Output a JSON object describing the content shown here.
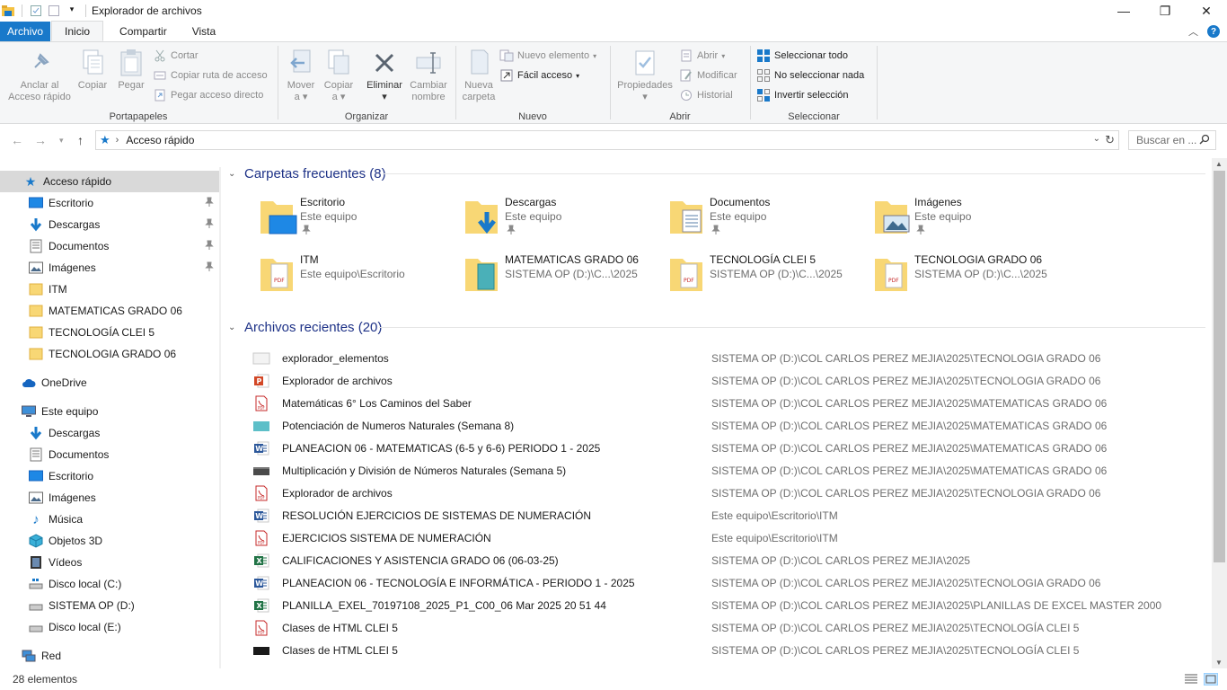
{
  "window": {
    "title": "Explorador de archivos",
    "controls": {
      "minimize": "—",
      "maximize": "❐",
      "close": "✕"
    }
  },
  "ribbon_tabs": [
    {
      "label": "Archivo"
    },
    {
      "label": "Inicio"
    },
    {
      "label": "Compartir"
    },
    {
      "label": "Vista"
    }
  ],
  "ribbon": {
    "portapapeles": {
      "label": "Portapapeles",
      "pin": "Anclar al\nAcceso rápido",
      "pin_1": "Anclar al",
      "pin_2": "Acceso rápido",
      "copy": "Copiar",
      "paste": "Pegar",
      "cut": "Cortar",
      "copy_path": "Copiar ruta de acceso",
      "paste_shortcut": "Pegar acceso directo"
    },
    "organizar": {
      "label": "Organizar",
      "move_1": "Mover",
      "move_2": "a",
      "copy_1": "Copiar",
      "copy_2": "a",
      "delete": "Eliminar",
      "rename_1": "Cambiar",
      "rename_2": "nombre"
    },
    "nuevo": {
      "label": "Nuevo",
      "new_folder_1": "Nueva",
      "new_folder_2": "carpeta",
      "new_item": "Nuevo elemento",
      "easy_access": "Fácil acceso"
    },
    "abrir": {
      "label": "Abrir",
      "properties": "Propiedades",
      "open": "Abrir",
      "edit": "Modificar",
      "history": "Historial"
    },
    "seleccionar": {
      "label": "Seleccionar",
      "select_all": "Seleccionar todo",
      "select_none": "No seleccionar nada",
      "invert": "Invertir selección"
    }
  },
  "address": {
    "path": "Acceso rápido",
    "search_placeholder": "Buscar en ..."
  },
  "nav": {
    "quick_access": "Acceso rápido",
    "quick_items": [
      "Escritorio",
      "Descargas",
      "Documentos",
      "Imágenes",
      "ITM",
      "MATEMATICAS GRADO 06",
      "TECNOLOGÍA CLEI 5",
      "TECNOLOGIA GRADO 06"
    ],
    "onedrive": "OneDrive",
    "this_pc": "Este equipo",
    "pc_items": [
      "Descargas",
      "Documentos",
      "Escritorio",
      "Imágenes",
      "Música",
      "Objetos 3D",
      "Vídeos",
      "Disco local (C:)",
      "SISTEMA OP (D:)",
      "Disco local (E:)"
    ],
    "network": "Red"
  },
  "frequent": {
    "header": "Carpetas frecuentes (8)",
    "items": [
      {
        "name": "Escritorio",
        "location": "Este equipo"
      },
      {
        "name": "Descargas",
        "location": "Este equipo"
      },
      {
        "name": "Documentos",
        "location": "Este equipo"
      },
      {
        "name": "Imágenes",
        "location": "Este equipo"
      },
      {
        "name": "ITM",
        "location": "Este equipo\\Escritorio"
      },
      {
        "name": "MATEMATICAS GRADO 06",
        "location": "SISTEMA OP (D:)\\C...\\2025"
      },
      {
        "name": "TECNOLOGÍA CLEI 5",
        "location": "SISTEMA OP (D:)\\C...\\2025"
      },
      {
        "name": "TECNOLOGIA GRADO 06",
        "location": "SISTEMA OP (D:)\\C...\\2025"
      }
    ]
  },
  "recent": {
    "header": "Archivos recientes (20)",
    "files": [
      {
        "name": "explorador_elementos",
        "path": "SISTEMA OP (D:)\\COL CARLOS PEREZ MEJIA\\2025\\TECNOLOGIA GRADO 06",
        "type": "image"
      },
      {
        "name": "Explorador de archivos",
        "path": "SISTEMA OP (D:)\\COL CARLOS PEREZ MEJIA\\2025\\TECNOLOGIA GRADO 06",
        "type": "ppt"
      },
      {
        "name": "Matemáticas 6° Los Caminos del Saber",
        "path": "SISTEMA OP (D:)\\COL CARLOS PEREZ MEJIA\\2025\\MATEMATICAS GRADO 06",
        "type": "pdf"
      },
      {
        "name": "Potenciación de Numeros Naturales (Semana 8)",
        "path": "SISTEMA OP (D:)\\COL CARLOS PEREZ MEJIA\\2025\\MATEMATICAS GRADO 06",
        "type": "image-teal"
      },
      {
        "name": "PLANEACION 06 - MATEMATICAS (6-5 y 6-6) PERIODO 1 - 2025",
        "path": "SISTEMA OP (D:)\\COL CARLOS PEREZ MEJIA\\2025\\MATEMATICAS GRADO 06",
        "type": "word"
      },
      {
        "name": "Multiplicación y División de Números Naturales (Semana 5)",
        "path": "SISTEMA OP (D:)\\COL CARLOS PEREZ MEJIA\\2025\\MATEMATICAS GRADO 06",
        "type": "image-dark"
      },
      {
        "name": "Explorador de archivos",
        "path": "SISTEMA OP (D:)\\COL CARLOS PEREZ MEJIA\\2025\\TECNOLOGIA GRADO 06",
        "type": "pdf"
      },
      {
        "name": "RESOLUCIÓN EJERCICIOS DE SISTEMAS DE NUMERACIÓN",
        "path": "Este equipo\\Escritorio\\ITM",
        "type": "word"
      },
      {
        "name": "EJERCICIOS SISTEMA DE NUMERACIÓN",
        "path": "Este equipo\\Escritorio\\ITM",
        "type": "pdf"
      },
      {
        "name": "CALIFICACIONES Y ASISTENCIA GRADO 06 (06-03-25)",
        "path": "SISTEMA OP (D:)\\COL CARLOS PEREZ MEJIA\\2025",
        "type": "excel"
      },
      {
        "name": "PLANEACION 06 - TECNOLOGÍA E INFORMÁTICA - PERIODO 1 - 2025",
        "path": "SISTEMA OP (D:)\\COL CARLOS PEREZ MEJIA\\2025\\TECNOLOGIA GRADO 06",
        "type": "word"
      },
      {
        "name": "PLANILLA_EXEL_70197108_2025_P1_C00_06 Mar 2025 20 51 44",
        "path": "SISTEMA OP (D:)\\COL CARLOS PEREZ MEJIA\\2025\\PLANILLAS DE EXCEL MASTER 2000",
        "type": "excel"
      },
      {
        "name": "Clases de HTML CLEI 5",
        "path": "SISTEMA OP (D:)\\COL CARLOS PEREZ MEJIA\\2025\\TECNOLOGÍA CLEI 5",
        "type": "pdf"
      },
      {
        "name": "Clases de HTML CLEI 5",
        "path": "SISTEMA OP (D:)\\COL CARLOS PEREZ MEJIA\\2025\\TECNOLOGÍA CLEI 5",
        "type": "image-black"
      }
    ]
  },
  "status": {
    "count": "28 elementos"
  },
  "colors": {
    "accent": "#1979ca",
    "folder": "#f5c242",
    "selected": "#d9d9d9",
    "section": "#1e3287"
  }
}
